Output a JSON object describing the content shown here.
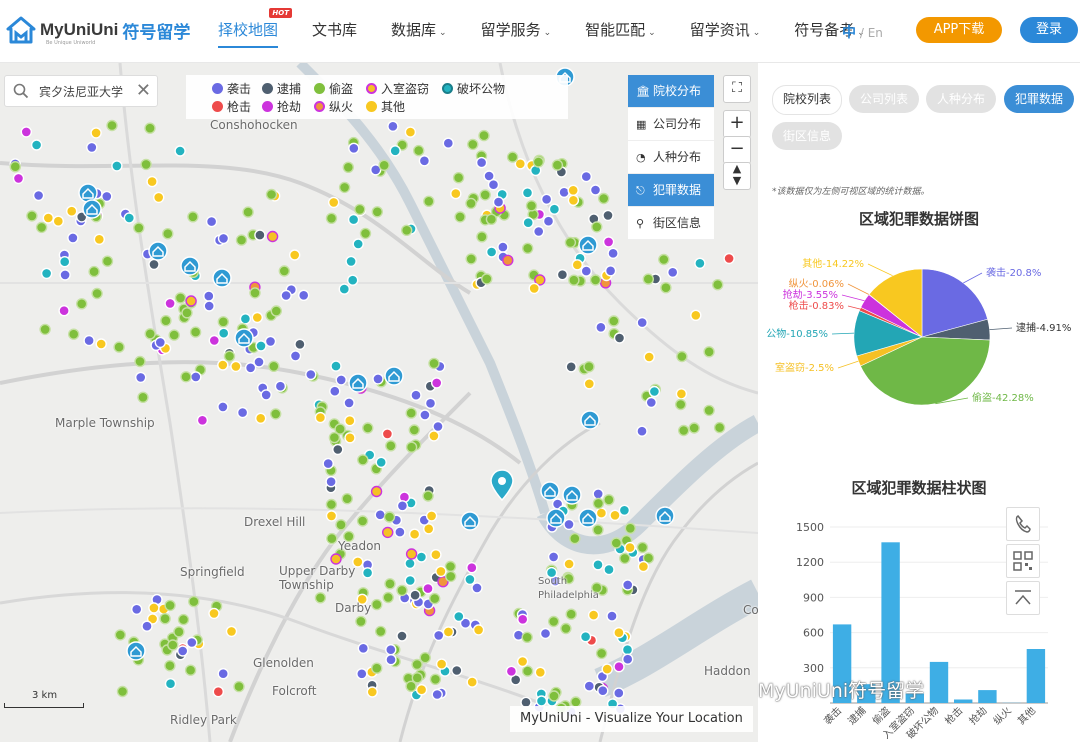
{
  "header": {
    "brand": "MyUniUni",
    "brand_cn": "符号留学",
    "brand_sub": "Be Unique Uniworld",
    "nav": [
      {
        "label": "择校地图",
        "dropdown": false,
        "active": true,
        "hot": "HOT"
      },
      {
        "label": "文书库",
        "dropdown": false
      },
      {
        "label": "数据库",
        "dropdown": true
      },
      {
        "label": "留学服务",
        "dropdown": true
      },
      {
        "label": "智能匹配",
        "dropdown": true
      },
      {
        "label": "留学资讯",
        "dropdown": true
      },
      {
        "label": "符号备考",
        "dropdown": true
      }
    ],
    "lang_zh": "中",
    "lang_sep": "/",
    "lang_en": "En",
    "app_button": "APP下载",
    "login_button": "登录"
  },
  "map": {
    "search_value": "宾夕法尼亚大学",
    "legend": [
      {
        "label": "袭击",
        "color": "#6a6ae3"
      },
      {
        "label": "逮捕",
        "color": "#4f5f70"
      },
      {
        "label": "偷盗",
        "color": "#7fbf3c"
      },
      {
        "label": "入室盗窃",
        "color": "#f5c024"
      },
      {
        "label": "破坏公物",
        "color": "#23b3c0"
      },
      {
        "label": "枪击",
        "color": "#ee4b4b"
      },
      {
        "label": "抢劫",
        "color": "#cc33dd"
      },
      {
        "label": "纵火",
        "color": "#f0953c"
      },
      {
        "label": "其他",
        "color": "#f8c820"
      }
    ],
    "layers": [
      {
        "label": "院校分布",
        "icon": "school-icon",
        "active": true
      },
      {
        "label": "公司分布",
        "icon": "building-icon",
        "active": false
      },
      {
        "label": "人种分布",
        "icon": "pie-icon",
        "active": false
      },
      {
        "label": "犯罪数据",
        "icon": "gun-icon",
        "active": true
      },
      {
        "label": "街区信息",
        "icon": "pin-icon",
        "active": false
      }
    ],
    "zoom_in": "+",
    "zoom_out": "−",
    "places": [
      "Conshohocken",
      "Marple Township",
      "Drexel Hill",
      "Yeadon",
      "Upper Darby Township",
      "Springfield",
      "Darby",
      "Glenolden",
      "Folcroft",
      "Ridley Park",
      "Haddon",
      "South Philadelphia",
      "Co"
    ],
    "scale": "3 km",
    "attribution": "MyUniUni - Visualize Your Location"
  },
  "panel": {
    "tabs": [
      {
        "label": "院校列表",
        "style": "plain"
      },
      {
        "label": "公司列表",
        "style": "gray"
      },
      {
        "label": "人种分布",
        "style": "gray"
      },
      {
        "label": "犯罪数据",
        "style": "active"
      },
      {
        "label": "街区信息",
        "style": "gray"
      }
    ],
    "note": "*该数据仅为左侧可视区域的统计数据。",
    "pie_title": "区域犯罪数据饼图",
    "bar_title": "区域犯罪数据柱状图",
    "watermark": "MyUniUni符号留学"
  },
  "chart_data": [
    {
      "type": "pie",
      "title": "区域犯罪数据饼图",
      "slices": [
        {
          "name": "袭击",
          "label": "袭击-20.8%",
          "value": 20.8,
          "color": "#6a6ae3"
        },
        {
          "name": "逮捕",
          "label": "逮捕-4.91%",
          "value": 4.91,
          "color": "#4f5f70"
        },
        {
          "name": "偷盗",
          "label": "偷盗-42.28%",
          "value": 42.28,
          "color": "#6fb847"
        },
        {
          "name": "入室盗窃",
          "label": "室盗窃-2.5%",
          "value": 2.5,
          "color": "#f5c024"
        },
        {
          "name": "破坏公物",
          "label": "公物-10.85%",
          "value": 10.85,
          "color": "#23a6b5"
        },
        {
          "name": "枪击",
          "label": "枪击-0.83%",
          "value": 0.83,
          "color": "#ee4b4b"
        },
        {
          "name": "抢劫",
          "label": "抢劫-3.55%",
          "value": 3.55,
          "color": "#cc33dd"
        },
        {
          "name": "纵火",
          "label": "纵火-0.06%",
          "value": 0.06,
          "color": "#f0953c"
        },
        {
          "name": "其他",
          "label": "其他-14.22%",
          "value": 14.22,
          "color": "#f8c820"
        }
      ]
    },
    {
      "type": "bar",
      "title": "区域犯罪数据柱状图",
      "categories": [
        "袭击",
        "逮捕",
        "偷盗",
        "入室盗窃",
        "破坏公物",
        "枪击",
        "抢劫",
        "纵火",
        "其他"
      ],
      "values": [
        670,
        160,
        1370,
        80,
        350,
        30,
        110,
        2,
        460
      ],
      "yticks": [
        "1500",
        "1200",
        "900",
        "600",
        "300"
      ],
      "ylim": [
        0,
        1500
      ],
      "color": "#3eaee5"
    }
  ]
}
